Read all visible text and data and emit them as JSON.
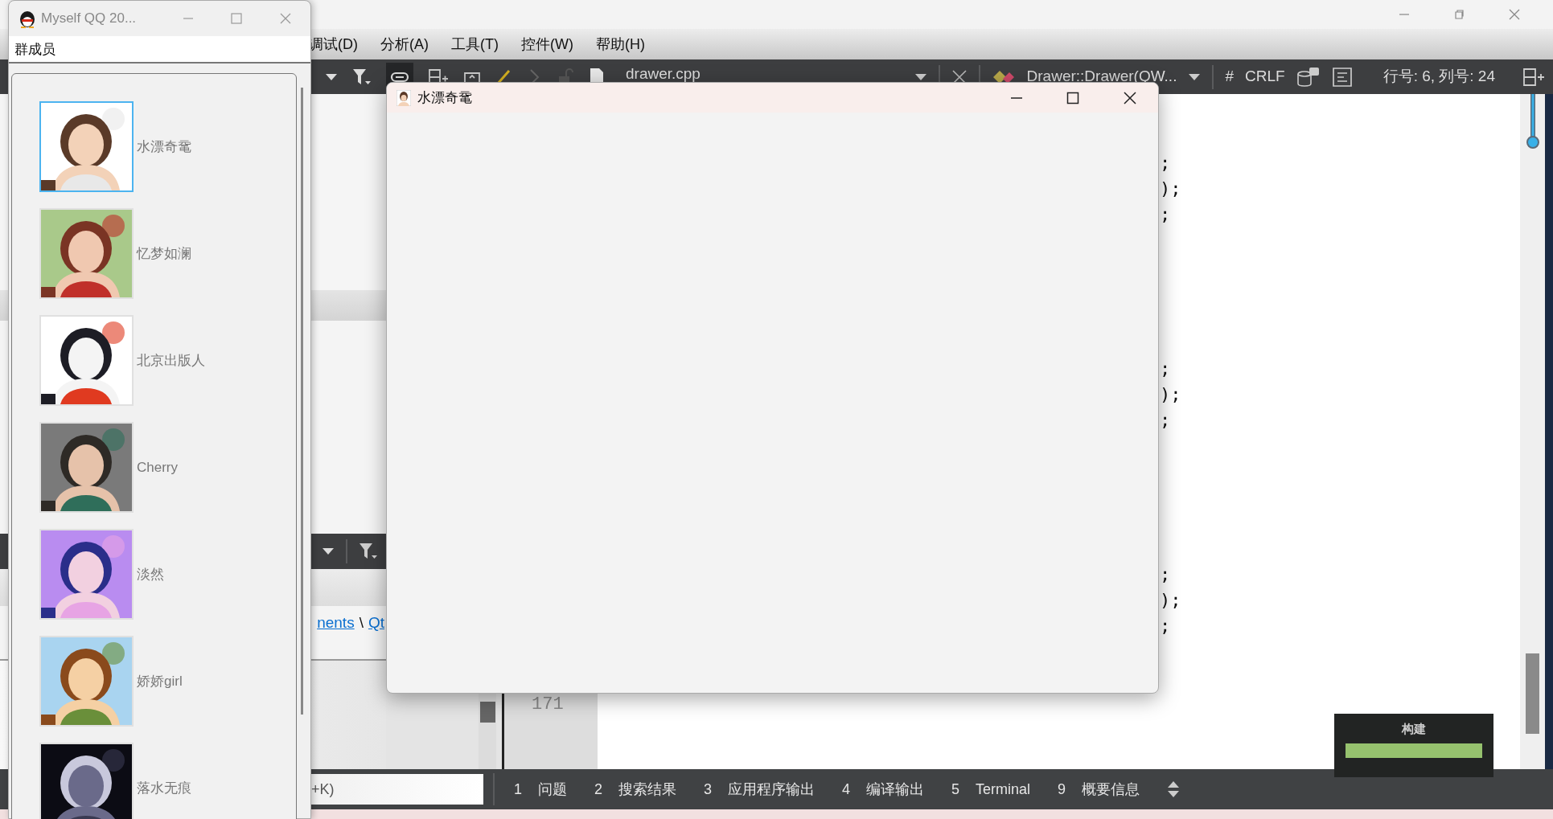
{
  "ide": {
    "menu": [
      "调试(D)",
      "分析(A)",
      "工具(T)",
      "控件(W)",
      "帮助(H)"
    ],
    "toolbar": {
      "file": "drawer.cpp",
      "symbol": "Drawer::Drawer(QW...",
      "hash": "#",
      "line_ending": "CRLF",
      "position": "行号: 6, 列号: 24"
    },
    "link_row": [
      {
        "text": "nents",
        "kind": "link"
      },
      {
        "text": "\\",
        "kind": "text"
      },
      {
        "text": "Qt",
        "kind": "link"
      }
    ],
    "code_blocks": [
      [
        ";",
        ");",
        ";"
      ],
      [
        ";",
        ");",
        ";"
      ],
      [
        ";",
        ");",
        ";"
      ]
    ],
    "line_number": "171",
    "search_hint": "+K)",
    "output_tabs": [
      {
        "number": "1",
        "label": "问题"
      },
      {
        "number": "2",
        "label": "搜索结果"
      },
      {
        "number": "3",
        "label": "应用程序输出"
      },
      {
        "number": "4",
        "label": "编译输出"
      },
      {
        "number": "5",
        "label": "Terminal"
      },
      {
        "number": "9",
        "label": "概要信息"
      }
    ],
    "build": {
      "label": "构建"
    }
  },
  "qq_window": {
    "title": "Myself QQ 20...",
    "header": "群成员",
    "members": [
      {
        "name": "水漂奇鼋",
        "selected": true
      },
      {
        "name": "忆梦如澜",
        "selected": false
      },
      {
        "name": "北京出版人",
        "selected": false
      },
      {
        "name": "Cherry",
        "selected": false
      },
      {
        "name": "淡然",
        "selected": false
      },
      {
        "name": "娇娇girl",
        "selected": false
      },
      {
        "name": "落水无痕",
        "selected": false
      }
    ]
  },
  "dialog": {
    "title": "水漂奇鼋"
  }
}
